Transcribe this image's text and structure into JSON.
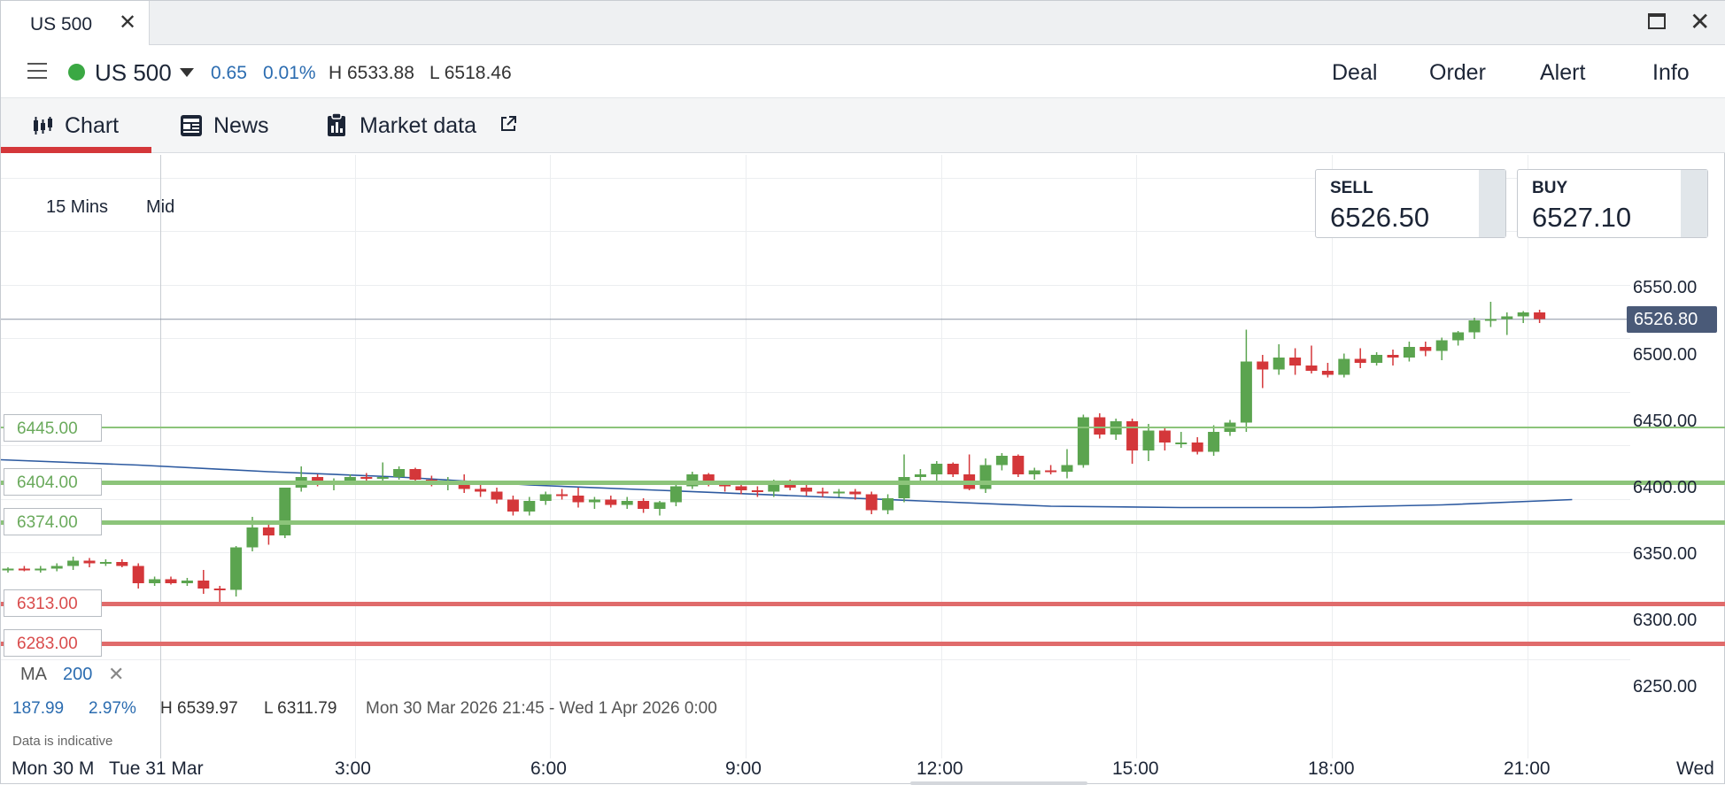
{
  "window": {
    "tab_title": "US 500"
  },
  "header": {
    "instrument": "US 500",
    "change_points": "0.65",
    "change_pct": "0.01%",
    "high": "H 6533.88",
    "low": "L 6518.46",
    "buttons": [
      "Deal",
      "Order",
      "Alert",
      "Info"
    ],
    "status_color": "#3aa843"
  },
  "tabs": [
    {
      "label": "Chart",
      "icon": "candlestick-icon",
      "active": true
    },
    {
      "label": "News",
      "icon": "newspaper-icon",
      "active": false
    },
    {
      "label": "Market data",
      "icon": "clipboard-icon",
      "active": false
    }
  ],
  "chart_toolbar": {
    "timeframe": "15 Mins",
    "price_type": "Mid"
  },
  "quotes": {
    "sell_label": "SELL",
    "sell_price": "6526.50",
    "buy_label": "BUY",
    "buy_price": "6527.10"
  },
  "current_price": "6526.80",
  "levels": [
    {
      "label": "6445.00",
      "value": 6445,
      "color": "#8cc47a"
    },
    {
      "label": "6404.00",
      "value": 6404,
      "color": "#8cc47a"
    },
    {
      "label": "6374.00",
      "value": 6374,
      "color": "#8cc47a"
    },
    {
      "label": "6313.00",
      "value": 6313,
      "color": "#e06b6b"
    },
    {
      "label": "6283.00",
      "value": 6283,
      "color": "#e06b6b"
    }
  ],
  "indicator": {
    "name": "MA",
    "period": "200"
  },
  "range_info": {
    "change": "187.99",
    "change_pct": "2.97%",
    "high": "H 6539.97",
    "low": "L 6311.79",
    "period": "Mon 30 Mar 2026 21:45 - Wed 1 Apr 2026 0:00"
  },
  "disclaimer": "Data is indicative",
  "colors": {
    "up": "#5ba44f",
    "down": "#d4373a",
    "ma_line": "#2d5aa0",
    "accent": "#d4373a"
  },
  "chart_data": {
    "type": "candlestick",
    "instrument": "US 500",
    "y_ticks": [
      "6550.00",
      "6500.00",
      "6450.00",
      "6400.00",
      "6350.00",
      "6300.00",
      "6250.00"
    ],
    "ylim": [
      6238,
      6558
    ],
    "x_ticks": [
      {
        "label": "Mon 30 M",
        "hour": -7.9
      },
      {
        "label": "Tue 31 Mar",
        "hour": -5.8
      },
      {
        "label": "3:00",
        "hour": 3
      },
      {
        "label": "6:00",
        "hour": 6
      },
      {
        "label": "9:00",
        "hour": 9
      },
      {
        "label": "12:00",
        "hour": 12
      },
      {
        "label": "15:00",
        "hour": 15
      },
      {
        "label": "18:00",
        "hour": 18
      },
      {
        "label": "21:00",
        "hour": 21
      },
      {
        "label": "Wed",
        "hour": 23.5
      }
    ],
    "candles": [
      [
        6338,
        6340,
        6336,
        6339
      ],
      [
        6339,
        6341,
        6337,
        6338
      ],
      [
        6338,
        6341,
        6336,
        6339
      ],
      [
        6339,
        6343,
        6337,
        6341
      ],
      [
        6341,
        6348,
        6338,
        6345
      ],
      [
        6345,
        6347,
        6340,
        6343
      ],
      [
        6343,
        6346,
        6341,
        6344
      ],
      [
        6344,
        6346,
        6340,
        6341
      ],
      [
        6341,
        6343,
        6324,
        6328
      ],
      [
        6328,
        6333,
        6326,
        6331
      ],
      [
        6331,
        6333,
        6327,
        6328
      ],
      [
        6328,
        6332,
        6326,
        6330
      ],
      [
        6330,
        6338,
        6320,
        6324
      ],
      [
        6324,
        6326,
        6311,
        6323
      ],
      [
        6323,
        6356,
        6318,
        6355
      ],
      [
        6355,
        6378,
        6352,
        6370
      ],
      [
        6370,
        6373,
        6357,
        6364
      ],
      [
        6364,
        6396,
        6362,
        6400
      ],
      [
        6400,
        6416,
        6397,
        6408
      ],
      [
        6408,
        6410,
        6401,
        6402
      ],
      [
        6402,
        6407,
        6398,
        6404
      ],
      [
        6404,
        6410,
        6402,
        6408
      ],
      [
        6408,
        6411,
        6402,
        6407
      ],
      [
        6407,
        6419,
        6405,
        6408
      ],
      [
        6408,
        6416,
        6406,
        6414
      ],
      [
        6414,
        6415,
        6404,
        6406
      ],
      [
        6406,
        6409,
        6401,
        6403
      ],
      [
        6403,
        6408,
        6398,
        6404
      ],
      [
        6404,
        6410,
        6396,
        6399
      ],
      [
        6399,
        6402,
        6393,
        6397
      ],
      [
        6397,
        6400,
        6388,
        6391
      ],
      [
        6391,
        6394,
        6379,
        6382
      ],
      [
        6382,
        6393,
        6379,
        6390
      ],
      [
        6390,
        6397,
        6387,
        6395
      ],
      [
        6395,
        6399,
        6391,
        6394
      ],
      [
        6394,
        6400,
        6385,
        6389
      ],
      [
        6389,
        6393,
        6384,
        6391
      ],
      [
        6391,
        6394,
        6385,
        6387
      ],
      [
        6387,
        6393,
        6384,
        6390
      ],
      [
        6390,
        6392,
        6381,
        6384
      ],
      [
        6384,
        6390,
        6379,
        6389
      ],
      [
        6389,
        6404,
        6386,
        6401
      ],
      [
        6401,
        6412,
        6399,
        6410
      ],
      [
        6410,
        6411,
        6401,
        6403
      ],
      [
        6403,
        6405,
        6397,
        6401
      ],
      [
        6401,
        6403,
        6395,
        6398
      ],
      [
        6398,
        6401,
        6393,
        6397
      ],
      [
        6397,
        6406,
        6393,
        6404
      ],
      [
        6404,
        6406,
        6398,
        6400
      ],
      [
        6400,
        6402,
        6394,
        6397
      ],
      [
        6397,
        6400,
        6393,
        6396
      ],
      [
        6396,
        6399,
        6393,
        6397
      ],
      [
        6397,
        6399,
        6391,
        6395
      ],
      [
        6395,
        6397,
        6380,
        6383
      ],
      [
        6383,
        6395,
        6380,
        6392
      ],
      [
        6392,
        6425,
        6389,
        6408
      ],
      [
        6408,
        6414,
        6403,
        6410
      ],
      [
        6410,
        6420,
        6405,
        6418
      ],
      [
        6418,
        6419,
        6408,
        6410
      ],
      [
        6410,
        6425,
        6398,
        6399
      ],
      [
        6399,
        6422,
        6396,
        6417
      ],
      [
        6417,
        6426,
        6413,
        6424
      ],
      [
        6424,
        6425,
        6408,
        6410
      ],
      [
        6410,
        6415,
        6406,
        6413
      ],
      [
        6413,
        6417,
        6410,
        6412
      ],
      [
        6412,
        6429,
        6407,
        6417
      ],
      [
        6417,
        6455,
        6415,
        6453
      ],
      [
        6453,
        6456,
        6437,
        6440
      ],
      [
        6440,
        6452,
        6436,
        6450
      ],
      [
        6450,
        6452,
        6418,
        6428
      ],
      [
        6428,
        6448,
        6420,
        6443
      ],
      [
        6443,
        6445,
        6428,
        6434
      ],
      [
        6434,
        6442,
        6430,
        6434
      ],
      [
        6434,
        6438,
        6425,
        6427
      ],
      [
        6427,
        6447,
        6424,
        6442
      ],
      [
        6442,
        6451,
        6439,
        6449
      ],
      [
        6449,
        6519,
        6442,
        6495
      ],
      [
        6495,
        6500,
        6475,
        6489
      ],
      [
        6489,
        6508,
        6485,
        6498
      ],
      [
        6498,
        6505,
        6485,
        6492
      ],
      [
        6492,
        6507,
        6486,
        6488
      ],
      [
        6488,
        6494,
        6483,
        6485
      ],
      [
        6485,
        6501,
        6483,
        6497
      ],
      [
        6497,
        6505,
        6490,
        6494
      ],
      [
        6494,
        6502,
        6492,
        6500
      ],
      [
        6500,
        6504,
        6492,
        6498
      ],
      [
        6498,
        6510,
        6495,
        6506
      ],
      [
        6506,
        6510,
        6499,
        6503
      ],
      [
        6503,
        6513,
        6496,
        6511
      ],
      [
        6511,
        6518,
        6507,
        6517
      ],
      [
        6517,
        6528,
        6512,
        6526
      ],
      [
        6526,
        6540,
        6521,
        6527
      ],
      [
        6527,
        6532,
        6515,
        6529
      ],
      [
        6529,
        6533,
        6524,
        6532
      ],
      [
        6532,
        6534,
        6524,
        6527
      ]
    ],
    "ma_200": {
      "name": "MA 200",
      "values": [
        6421,
        6417,
        6412,
        6408,
        6402,
        6398,
        6394,
        6390,
        6386,
        6385,
        6385,
        6387,
        6391
      ],
      "t": [
        0,
        8,
        16,
        24,
        32,
        40,
        48,
        56,
        64,
        72,
        80,
        88,
        96
      ]
    }
  }
}
